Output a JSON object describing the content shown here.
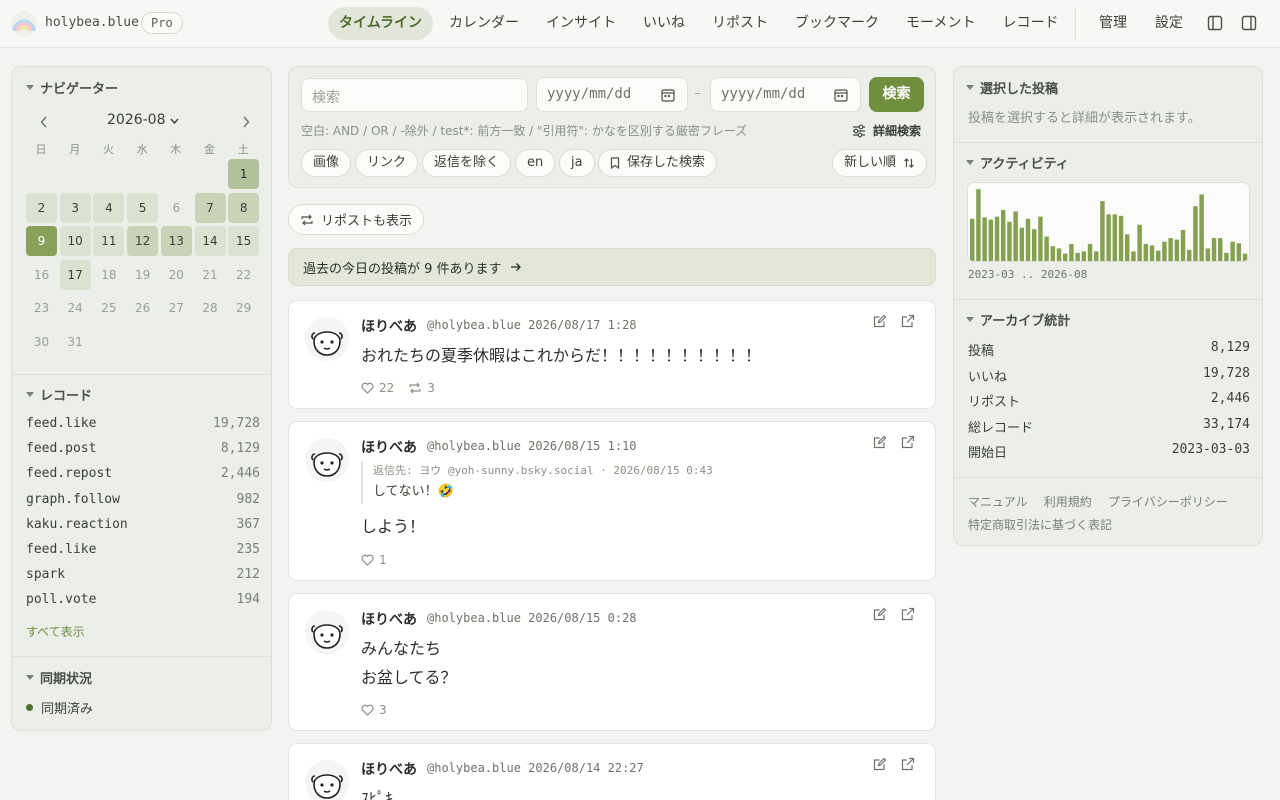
{
  "header": {
    "brand": "holybea.blue",
    "badge": "Pro",
    "nav": [
      "タイムライン",
      "カレンダー",
      "インサイト",
      "いいね",
      "リポスト",
      "ブックマーク",
      "モーメント",
      "レコード"
    ],
    "active_nav": "タイムライン",
    "admin": "管理",
    "settings": "設定"
  },
  "navigator": {
    "title": "ナビゲーター",
    "month": "2026-08",
    "weekdays": [
      "日",
      "月",
      "火",
      "水",
      "木",
      "金",
      "土"
    ],
    "days": [
      {
        "d": "1",
        "level": 3
      },
      {
        "d": "2",
        "level": 1
      },
      {
        "d": "3",
        "level": 1
      },
      {
        "d": "4",
        "level": 1
      },
      {
        "d": "5",
        "level": 1
      },
      {
        "d": "6",
        "level": 0
      },
      {
        "d": "7",
        "level": 2
      },
      {
        "d": "8",
        "level": 2
      },
      {
        "d": "9",
        "level": 4
      },
      {
        "d": "10",
        "level": 1
      },
      {
        "d": "11",
        "level": 1
      },
      {
        "d": "12",
        "level": 2
      },
      {
        "d": "13",
        "level": 2
      },
      {
        "d": "14",
        "level": 1
      },
      {
        "d": "15",
        "level": 1
      },
      {
        "d": "16",
        "level": 0
      },
      {
        "d": "17",
        "level": 1
      },
      {
        "d": "18",
        "level": 0
      },
      {
        "d": "19",
        "level": 0
      },
      {
        "d": "20",
        "level": 0
      },
      {
        "d": "21",
        "level": 0
      },
      {
        "d": "22",
        "level": 0
      },
      {
        "d": "23",
        "level": 0
      },
      {
        "d": "24",
        "level": 0
      },
      {
        "d": "25",
        "level": 0
      },
      {
        "d": "26",
        "level": 0
      },
      {
        "d": "27",
        "level": 0
      },
      {
        "d": "28",
        "level": 0
      },
      {
        "d": "29",
        "level": 0
      },
      {
        "d": "30",
        "level": 0
      },
      {
        "d": "31",
        "level": 0
      }
    ]
  },
  "records": {
    "title": "レコード",
    "items": [
      {
        "name": "feed.like",
        "count": "19,728"
      },
      {
        "name": "feed.post",
        "count": "8,129"
      },
      {
        "name": "feed.repost",
        "count": "2,446"
      },
      {
        "name": "graph.follow",
        "count": "982"
      },
      {
        "name": "kaku.reaction",
        "count": "367"
      },
      {
        "name": "feed.like",
        "count": "235"
      },
      {
        "name": "spark",
        "count": "212"
      },
      {
        "name": "poll.vote",
        "count": "194"
      }
    ],
    "show_all": "すべて表示"
  },
  "sync": {
    "title": "同期状況",
    "status": "同期済み",
    "status_color": "#4e6e2c"
  },
  "search": {
    "placeholder": "検索",
    "date_from": "yyyy/mm/dd",
    "date_to": "yyyy/mm/dd",
    "dash": "–",
    "button": "検索",
    "hint": "空白: AND / OR / -除外 / test*: 前方一致 / \"引用符\": かなを区別する厳密フレーズ",
    "advanced": "詳細検索",
    "chips": [
      "画像",
      "リンク",
      "返信を除く",
      "en",
      "ja"
    ],
    "saved": "保存した検索",
    "sort": "新しい順"
  },
  "repost_toggle": "リポストも表示",
  "on_this_day": "過去の今日の投稿が 9 件あります",
  "posts": [
    {
      "name": "ほりべあ",
      "meta": "@holybea.blue 2026/08/17 1:28",
      "lines": [
        "おれたちの夏季休暇はこれからだ！！！！！！！！！！"
      ],
      "likes": "22",
      "reposts": "3"
    },
    {
      "name": "ほりべあ",
      "meta": "@holybea.blue 2026/08/15 1:10",
      "reply_meta": "返信先: ヨウ @yoh-sunny.bsky.social · 2026/08/15 0:43",
      "reply_text": "してない！🤣",
      "lines": [
        "しよう！"
      ],
      "likes": "1"
    },
    {
      "name": "ほりべあ",
      "meta": "@holybea.blue 2026/08/15 0:28",
      "lines": [
        "みんなたち",
        "お盆してる？"
      ],
      "likes": "3"
    },
    {
      "name": "ほりべあ",
      "meta": "@holybea.blue 2026/08/14 22:27",
      "lines": [
        "ｽﾋﾟｷ"
      ]
    }
  ],
  "selected": {
    "title": "選択した投稿",
    "empty": "投稿を選択すると詳細が表示されます。"
  },
  "activity": {
    "title": "アクティビティ",
    "range": "2023-03 .. 2026-08",
    "bar_color": "#86a052",
    "values": [
      0.57,
      0.97,
      0.59,
      0.56,
      0.6,
      0.69,
      0.53,
      0.67,
      0.45,
      0.57,
      0.43,
      0.6,
      0.33,
      0.2,
      0.17,
      0.1,
      0.23,
      0.11,
      0.13,
      0.23,
      0.13,
      0.81,
      0.63,
      0.63,
      0.61,
      0.36,
      0.13,
      0.49,
      0.23,
      0.21,
      0.14,
      0.26,
      0.31,
      0.29,
      0.42,
      0.15,
      0.74,
      0.9,
      0.17,
      0.31,
      0.31,
      0.11,
      0.26,
      0.24,
      0.1
    ]
  },
  "archive": {
    "title": "アーカイブ統計",
    "rows": [
      {
        "k": "投稿",
        "v": "8,129"
      },
      {
        "k": "いいね",
        "v": "19,728"
      },
      {
        "k": "リポスト",
        "v": "2,446"
      },
      {
        "k": "総レコード",
        "v": "33,174"
      },
      {
        "k": "開始日",
        "v": "2023-03-03"
      }
    ]
  },
  "footer_links": [
    "マニュアル",
    "利用規約",
    "プライバシーポリシー",
    "特定商取引法に基づく表記"
  ]
}
